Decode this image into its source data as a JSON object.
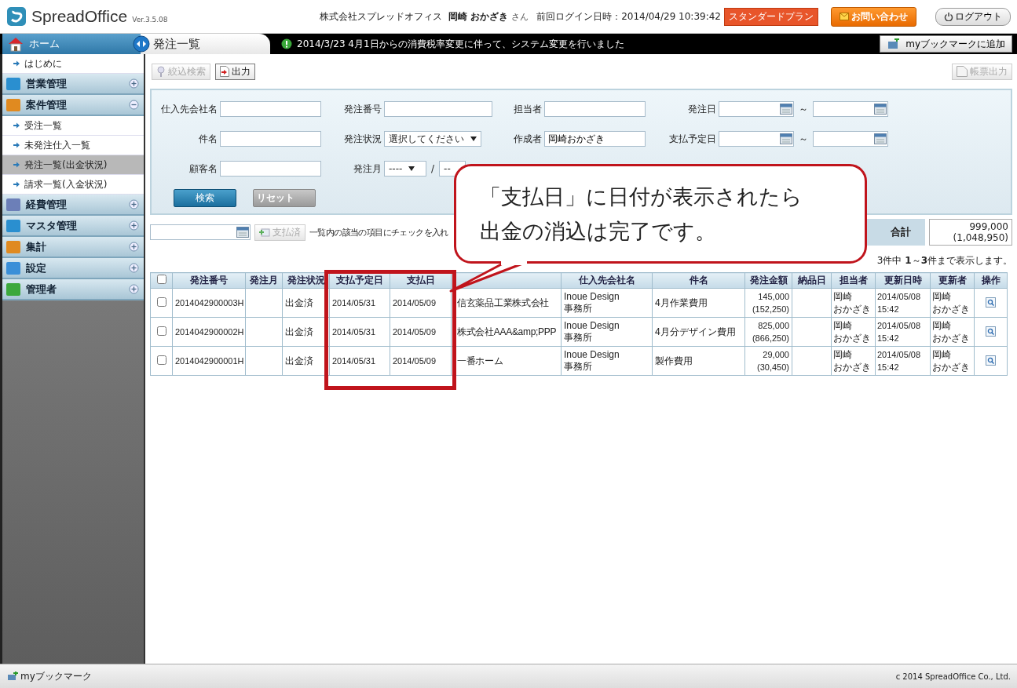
{
  "header": {
    "logo": "SpreadOffice",
    "version": "Ver.3.5.08",
    "company": "株式会社スプレッドオフィス",
    "user": "岡崎 おかざき",
    "honorific": "さん",
    "last_login": "前回ログイン日時：2014/04/29 10:39:42",
    "plan": "スタンダードプラン",
    "contact_button": "お問い合わせ",
    "logout_button": "ログアウト"
  },
  "nav": {
    "home": "ホーム",
    "page_title": "発注一覧",
    "notice": "2014/3/23  4月1日からの消費税率変更に伴って、システム変更を行いました",
    "bookmark_button": "myブックマークに追加"
  },
  "sidebar": {
    "items": [
      {
        "kind": "link",
        "label": "はじめに",
        "selected": false
      },
      {
        "kind": "section",
        "label": "営業管理",
        "expanded": false
      },
      {
        "kind": "section",
        "label": "案件管理",
        "expanded": true
      },
      {
        "kind": "link",
        "label": "受注一覧",
        "selected": false
      },
      {
        "kind": "link",
        "label": "未発注仕入一覧",
        "selected": false
      },
      {
        "kind": "link",
        "label": "発注一覧(出金状況)",
        "selected": true
      },
      {
        "kind": "link",
        "label": "請求一覧(入金状況)",
        "selected": false
      },
      {
        "kind": "section",
        "label": "経費管理",
        "expanded": false
      },
      {
        "kind": "section",
        "label": "マスタ管理",
        "expanded": false
      },
      {
        "kind": "section",
        "label": "集計",
        "expanded": false
      },
      {
        "kind": "section",
        "label": "設定",
        "expanded": false
      },
      {
        "kind": "section",
        "label": "管理者",
        "expanded": false
      }
    ]
  },
  "toolbar": {
    "buttons": [
      {
        "label": "絞込検索",
        "disabled": true
      },
      {
        "label": "出力",
        "disabled": false
      }
    ],
    "report_button": {
      "label": "帳票出力",
      "disabled": true
    }
  },
  "search": {
    "rows": [
      [
        {
          "kind": "text",
          "label": "仕入先会社名"
        },
        {
          "kind": "text",
          "label": "発注番号"
        },
        {
          "kind": "text",
          "label": "担当者"
        },
        {
          "kind": "range",
          "label": "発注日",
          "separator": "～"
        }
      ],
      [
        {
          "kind": "text",
          "label": "件名"
        },
        {
          "kind": "select",
          "label": "発注状況",
          "value": "選択してください"
        },
        {
          "kind": "text",
          "label": "作成者",
          "value": "岡崎おかざき"
        },
        {
          "kind": "range",
          "label": "支払予定日",
          "separator": "～"
        }
      ],
      [
        {
          "kind": "text",
          "label": "顧客名"
        },
        {
          "kind": "month",
          "label": "発注月",
          "year": "----",
          "separator": "/",
          "month": "--"
        }
      ]
    ],
    "buttons": [
      {
        "label": "検索",
        "kind": "primary"
      },
      {
        "label": "リセット",
        "kind": "secondary"
      }
    ]
  },
  "actions": {
    "paid_button": "支払済",
    "hint": "一覧内の該当の項目にチェックを入れ",
    "total_label": "合計",
    "total": "999,000",
    "total_tax": "(1,048,950)"
  },
  "pager": "3件中 **1**～**3**件まで表示します。",
  "table": {
    "columns": [
      {
        "label": "発注番号"
      },
      {
        "label": "発注月"
      },
      {
        "label": "発注状況"
      },
      {
        "label": "支払予定日"
      },
      {
        "label": "支払日"
      },
      {},
      {
        "label": "仕入先会社名"
      },
      {
        "label": "件名"
      },
      {
        "label": "発注金額"
      },
      {
        "label": "納品日"
      },
      {
        "label": "担当者"
      },
      {
        "label": "更新日時"
      },
      {
        "label": "更新者"
      },
      {
        "label": "操作"
      }
    ],
    "header_checked": false,
    "rows": [
      {
        "checked": false,
        "number": "2014042900003H",
        "status": "出金済",
        "due": "2014/05/31",
        "paid": "2014/05/09",
        "customer": "信玄薬品工業株式会社",
        "supplier": "Inoue Design 事務所",
        "subject": "4月作業費用",
        "amount": "145,000",
        "amount_tax": "(152,250)",
        "staff": [
          "岡崎",
          "おかざき"
        ],
        "updated": "2014/05/08 15:42",
        "updater": [
          "岡崎",
          "おかざき"
        ]
      },
      {
        "checked": false,
        "number": "2014042900002H",
        "status": "出金済",
        "due": "2014/05/31",
        "paid": "2014/05/09",
        "customer": "株式会社AAA&amp;PPP",
        "supplier": "Inoue Design 事務所",
        "subject": "4月分デザイン費用",
        "amount": "825,000",
        "amount_tax": "(866,250)",
        "staff": [
          "岡崎",
          "おかざき"
        ],
        "updated": "2014/05/08 15:42",
        "updater": [
          "岡崎",
          "おかざき"
        ]
      },
      {
        "checked": false,
        "number": "2014042900001H",
        "status": "出金済",
        "due": "2014/05/31",
        "paid": "2014/05/09",
        "customer": "一番ホーム",
        "supplier": "Inoue Design 事務所",
        "subject": "製作費用",
        "amount": "29,000",
        "amount_tax": "(30,450)",
        "staff": [
          "岡崎",
          "おかざき"
        ],
        "updated": "2014/05/08 15:42",
        "updater": [
          "岡崎",
          "おかざき"
        ]
      }
    ]
  },
  "callout": {
    "lines": [
      "「支払日」に日付が表示されたら",
      "出金の消込は完了です。"
    ]
  },
  "footer": {
    "bookmark": "myブックマーク",
    "copyright": "c 2014 SpreadOffice Co., Ltd."
  }
}
